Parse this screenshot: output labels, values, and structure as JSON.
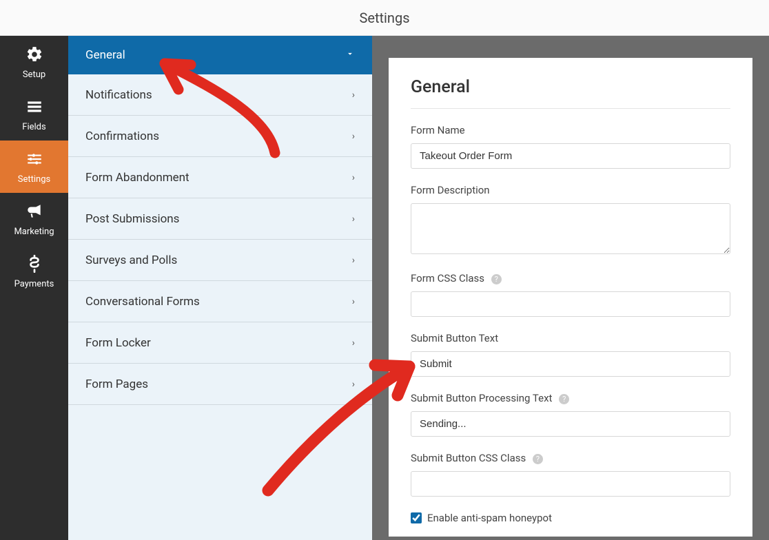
{
  "header": {
    "title": "Settings"
  },
  "leftNav": {
    "items": [
      {
        "key": "setup",
        "label": "Setup",
        "icon": "gear"
      },
      {
        "key": "fields",
        "label": "Fields",
        "icon": "list"
      },
      {
        "key": "settings",
        "label": "Settings",
        "icon": "sliders",
        "active": true
      },
      {
        "key": "marketing",
        "label": "Marketing",
        "icon": "bullhorn"
      },
      {
        "key": "payments",
        "label": "Payments",
        "icon": "dollar"
      }
    ]
  },
  "settingsSidebar": {
    "items": [
      {
        "label": "General",
        "expanded": true
      },
      {
        "label": "Notifications"
      },
      {
        "label": "Confirmations"
      },
      {
        "label": "Form Abandonment"
      },
      {
        "label": "Post Submissions"
      },
      {
        "label": "Surveys and Polls"
      },
      {
        "label": "Conversational Forms"
      },
      {
        "label": "Form Locker"
      },
      {
        "label": "Form Pages"
      }
    ]
  },
  "panel": {
    "title": "General",
    "fields": {
      "formName": {
        "label": "Form Name",
        "value": "Takeout Order Form"
      },
      "formDescription": {
        "label": "Form Description",
        "value": ""
      },
      "formCssClass": {
        "label": "Form CSS Class",
        "value": "",
        "help": true
      },
      "submitButtonText": {
        "label": "Submit Button Text",
        "value": "Submit"
      },
      "submitButtonProcessingText": {
        "label": "Submit Button Processing Text",
        "value": "Sending...",
        "help": true
      },
      "submitButtonCssClass": {
        "label": "Submit Button CSS Class",
        "value": "",
        "help": true
      },
      "antiSpam": {
        "label": "Enable anti-spam honeypot",
        "checked": true
      }
    }
  },
  "colors": {
    "navBg": "#2d2d2d",
    "activeOrange": "#e27730",
    "sidebarBlue": "#0f6aa8",
    "sidebarBg": "#ebf3f9",
    "canvasBg": "#6b6b6b",
    "annotationRed": "#e02a1f"
  }
}
